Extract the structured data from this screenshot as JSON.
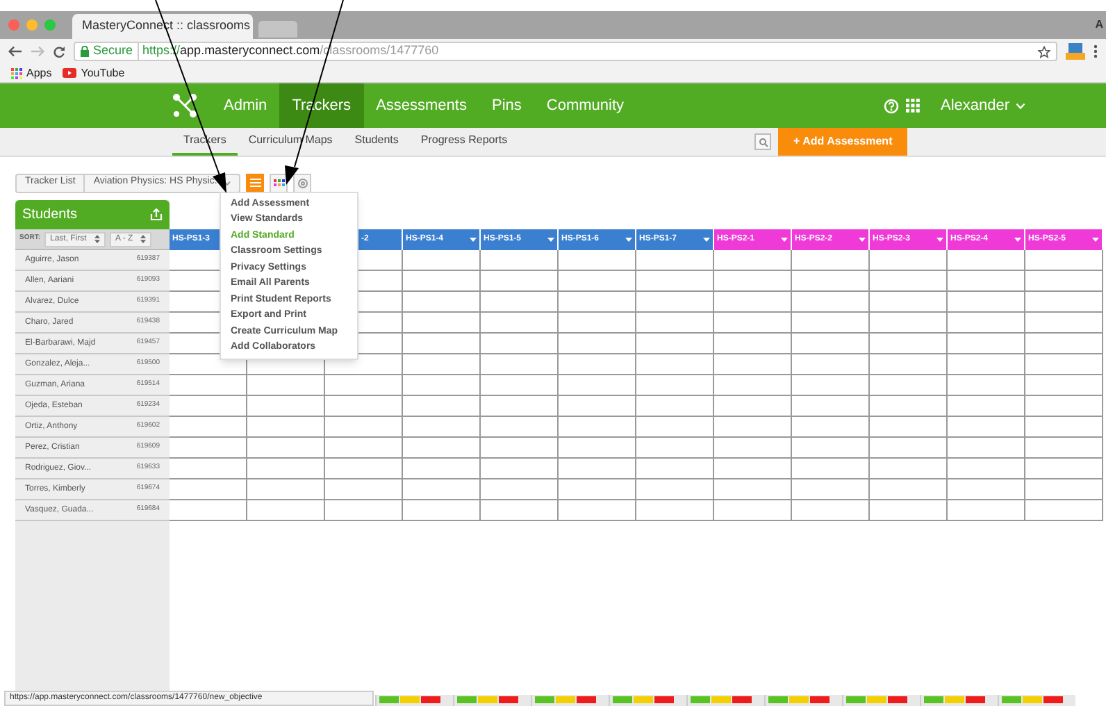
{
  "browser": {
    "tab_title": "MasteryConnect :: classrooms",
    "secure_label": "Secure",
    "url_scheme": "https://",
    "url_host": "app.masteryconnect.com",
    "url_path": "/classrooms/1477760",
    "bookmarks": [
      "Apps",
      "YouTube"
    ],
    "profile": "A"
  },
  "nav": {
    "items": [
      {
        "label": "Admin",
        "selected": false
      },
      {
        "label": "Trackers",
        "selected": true
      },
      {
        "label": "Assessments",
        "selected": false
      },
      {
        "label": "Pins",
        "selected": false
      },
      {
        "label": "Community",
        "selected": false
      }
    ],
    "user": "Alexander"
  },
  "subnav": {
    "items": [
      {
        "label": "Trackers",
        "selected": true
      },
      {
        "label": "Curriculum Maps",
        "selected": false
      },
      {
        "label": "Students",
        "selected": false
      },
      {
        "label": "Progress Reports",
        "selected": false
      }
    ],
    "add_button": "+ Add Assessment"
  },
  "toolbar": {
    "tracker_list": "Tracker List",
    "tracker_select": "Aviation Physics: HS Physic:"
  },
  "menu": {
    "items": [
      {
        "label": "Add Assessment",
        "selected": false
      },
      {
        "label": "View Standards",
        "selected": false
      },
      {
        "label": "Add Standard",
        "selected": true
      },
      {
        "label": "Classroom Settings",
        "selected": false
      },
      {
        "label": "Privacy Settings",
        "selected": false
      },
      {
        "label": "Email All Parents",
        "selected": false
      },
      {
        "label": "Print Student Reports",
        "selected": false
      },
      {
        "label": "Export and Print",
        "selected": false
      },
      {
        "label": "Create Curriculum Map",
        "selected": false
      },
      {
        "label": "Add Collaborators",
        "selected": false
      }
    ]
  },
  "students": {
    "title": "Students",
    "sort_label": "SORT:",
    "sort_by": "Last, First",
    "sort_order": "A - Z",
    "rows": [
      {
        "name": "Aguirre, Jason",
        "id": "619387"
      },
      {
        "name": "Allen, Aariani",
        "id": "619093"
      },
      {
        "name": "Alvarez, Dulce",
        "id": "619391"
      },
      {
        "name": "Charo, Jared",
        "id": "619438"
      },
      {
        "name": "El-Barbarawi, Majd",
        "id": "619457"
      },
      {
        "name": "Gonzalez, Aleja...",
        "id": "619500"
      },
      {
        "name": "Guzman, Ariana",
        "id": "619514"
      },
      {
        "name": "Ojeda, Esteban",
        "id": "619234"
      },
      {
        "name": "Ortiz, Anthony",
        "id": "619602"
      },
      {
        "name": "Perez, Cristian",
        "id": "619609"
      },
      {
        "name": "Rodriguez, Giov...",
        "id": "619633"
      },
      {
        "name": "Torres, Kimberly",
        "id": "619674"
      },
      {
        "name": "Vasquez, Guada...",
        "id": "619684"
      }
    ]
  },
  "table": {
    "columns": [
      {
        "label": "HS-PS1-3",
        "color": "#3a7fd0"
      },
      {},
      {
        "label": "-2",
        "color": "#3a7fd0"
      },
      {
        "label": "HS-PS1-4",
        "color": "#3a7fd0"
      },
      {
        "label": "HS-PS1-5",
        "color": "#3a7fd0"
      },
      {
        "label": "HS-PS1-6",
        "color": "#3a7fd0"
      },
      {
        "label": "HS-PS1-7",
        "color": "#3a7fd0"
      },
      {
        "label": "HS-PS2-1",
        "color": "#f03ad8"
      },
      {
        "label": "HS-PS2-2",
        "color": "#f03ad8"
      },
      {
        "label": "HS-PS2-3",
        "color": "#f03ad8"
      },
      {
        "label": "HS-PS2-4",
        "color": "#f03ad8"
      },
      {
        "label": "HS-PS2-5",
        "color": "#f03ad8"
      }
    ]
  },
  "status_url": "https://app.masteryconnect.com/classrooms/1477760/new_objective"
}
